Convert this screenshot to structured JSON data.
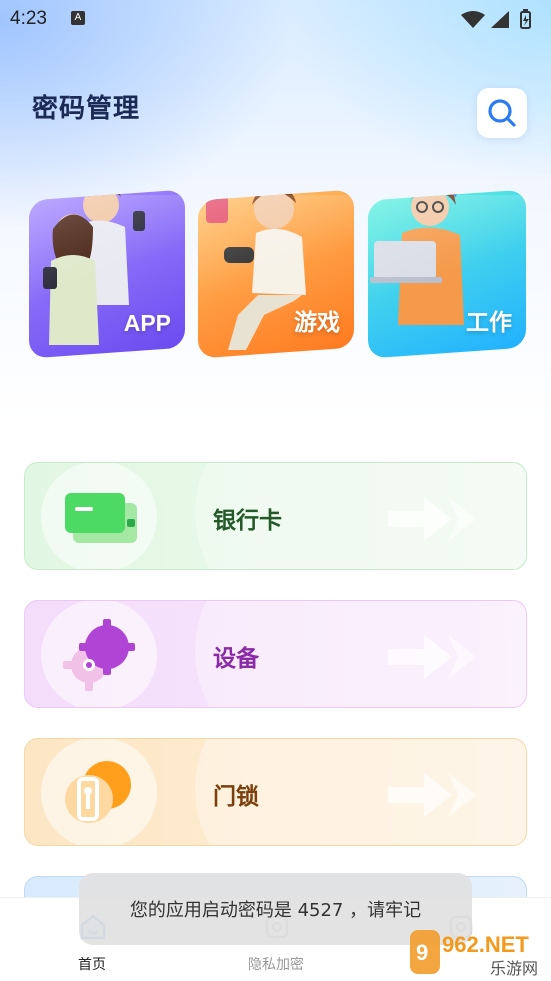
{
  "status_bar": {
    "time": "4:23",
    "notification_letter": "A",
    "icons": [
      "wifi-icon",
      "signal-icon",
      "battery-icon"
    ]
  },
  "header": {
    "title": "密码管理",
    "search_icon": "search-icon"
  },
  "categories": [
    {
      "label": "APP",
      "color": "#7b5cf5"
    },
    {
      "label": "游戏",
      "color": "#ff8a2a"
    },
    {
      "label": "工作",
      "color": "#2bb8f8"
    }
  ],
  "list_cards": [
    {
      "title": "银行卡",
      "icon": "bank-card-icon",
      "color": "#4cd964"
    },
    {
      "title": "设备",
      "icon": "gear-icon",
      "color": "#b044d4"
    },
    {
      "title": "门锁",
      "icon": "door-lock-icon",
      "color": "#ff9f1c"
    }
  ],
  "bottom_nav": {
    "items": [
      {
        "label": "首页",
        "icon": "home-icon",
        "active": true
      },
      {
        "label": "隐私加密",
        "icon": "lock-icon",
        "active": false
      },
      {
        "label": "",
        "icon": "profile-icon",
        "active": false
      }
    ]
  },
  "toast": {
    "message": "您的应用启动密码是 4527 ，请牢记"
  },
  "watermark": {
    "text_top": "962.NET",
    "text_bottom": "乐游网"
  },
  "colors": {
    "accent": "#2a7cf0",
    "title": "#1b2a55"
  }
}
